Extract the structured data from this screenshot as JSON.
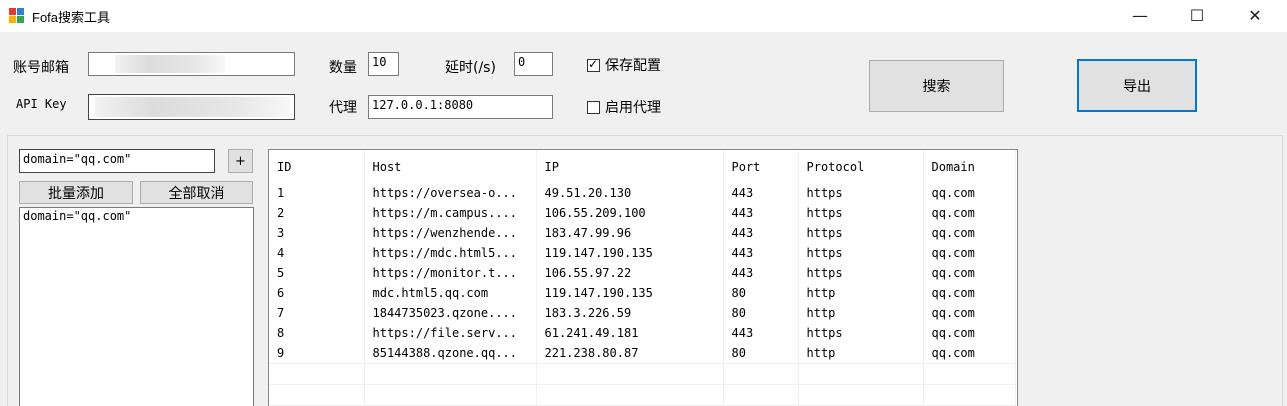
{
  "window": {
    "title": "Fofa搜索工具",
    "minimize_glyph": "—",
    "maximize_glyph": "☐",
    "close_glyph": "✕"
  },
  "form": {
    "email_label": "账号邮箱",
    "email_value": "",
    "apikey_label": "API Key",
    "apikey_value": "",
    "count_label": "数量",
    "count_value": "10",
    "delay_label": "延时(/s)",
    "delay_value": "0",
    "proxy_label": "代理",
    "proxy_value": "127.0.0.1:8080",
    "save_config_label": "保存配置",
    "save_config_checked": true,
    "enable_proxy_label": "启用代理",
    "enable_proxy_checked": false,
    "search_button": "搜索",
    "export_button": "导出"
  },
  "query_panel": {
    "query_value": "domain=\"qq.com\"",
    "add_button": "+",
    "batch_add_button": "批量添加",
    "cancel_all_button": "全部取消",
    "query_list": [
      "domain=\"qq.com\""
    ]
  },
  "results": {
    "columns": [
      "ID",
      "Host",
      "IP",
      "Port",
      "Protocol",
      "Domain"
    ],
    "rows": [
      [
        "1",
        "https://oversea-o...",
        "49.51.20.130",
        "443",
        "https",
        "qq.com"
      ],
      [
        "2",
        "https://m.campus....",
        "106.55.209.100",
        "443",
        "https",
        "qq.com"
      ],
      [
        "3",
        "https://wenzhende...",
        "183.47.99.96",
        "443",
        "https",
        "qq.com"
      ],
      [
        "4",
        "https://mdc.html5...",
        "119.147.190.135",
        "443",
        "https",
        "qq.com"
      ],
      [
        "5",
        "https://monitor.t...",
        "106.55.97.22",
        "443",
        "https",
        "qq.com"
      ],
      [
        "6",
        "mdc.html5.qq.com",
        "119.147.190.135",
        "80",
        "http",
        "qq.com"
      ],
      [
        "7",
        "1844735023.qzone....",
        "183.3.226.59",
        "80",
        "http",
        "qq.com"
      ],
      [
        "8",
        "https://file.serv...",
        "61.241.49.181",
        "443",
        "https",
        "qq.com"
      ],
      [
        "9",
        "85144388.qzone.qq...",
        "221.238.80.87",
        "80",
        "http",
        "qq.com"
      ]
    ]
  }
}
